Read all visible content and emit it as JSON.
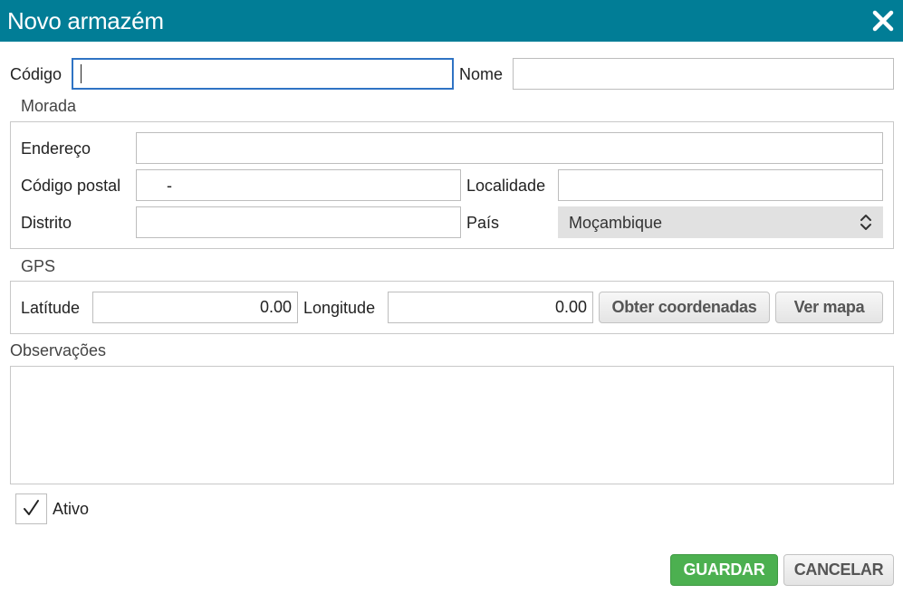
{
  "dialog": {
    "title": "Novo armazém",
    "close_icon": "close-icon"
  },
  "header_fields": {
    "codigo_label": "Código",
    "codigo_value": "",
    "nome_label": "Nome",
    "nome_value": ""
  },
  "morada": {
    "legend": "Morada",
    "endereco_label": "Endereço",
    "endereco_value": "",
    "codigo_postal_label": "Código postal",
    "codigo_postal_separator": "-",
    "localidade_label": "Localidade",
    "localidade_value": "",
    "distrito_label": "Distrito",
    "distrito_value": "",
    "pais_label": "País",
    "pais_selected": "Moçambique"
  },
  "gps": {
    "legend": "GPS",
    "latitude_label": "Latítude",
    "latitude_value": "0.00",
    "longitude_label": "Longitude",
    "longitude_value": "0.00",
    "obter_button": "Obter coordenadas",
    "ver_mapa_button": "Ver mapa"
  },
  "observacoes": {
    "label": "Observações",
    "value": ""
  },
  "ativo": {
    "label": "Ativo",
    "checked": true
  },
  "footer": {
    "guardar_button": "GUARDAR",
    "cancelar_button": "CANCELAR"
  },
  "colors": {
    "titlebar": "#017d96",
    "primary_button": "#4cb050",
    "focus_border": "#2f73c4"
  }
}
